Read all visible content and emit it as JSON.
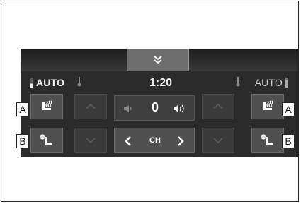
{
  "display": {
    "left_zone": {
      "mode": "AUTO"
    },
    "right_zone": {
      "mode": "AUTO"
    },
    "clock": "1:20",
    "volume": {
      "value": "0"
    },
    "channel": {
      "label": "CH"
    }
  },
  "callouts": {
    "left_top": "A",
    "left_bottom": "B",
    "right_top": "A",
    "right_bottom": "B"
  }
}
